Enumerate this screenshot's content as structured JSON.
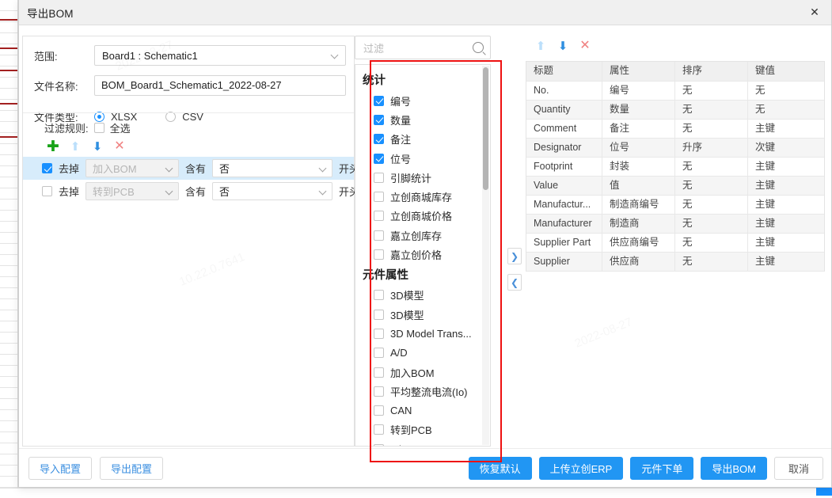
{
  "window": {
    "title": "导出BOM",
    "close_icon": "close-icon"
  },
  "form": {
    "scope_label": "范围:",
    "scope_value": "Board1 : Schematic1",
    "filename_label": "文件名称:",
    "filename_value": "BOM_Board1_Schematic1_2022-08-27",
    "filetype_label": "文件类型:",
    "filetype_options": [
      {
        "label": "XLSX",
        "checked": true
      },
      {
        "label": "CSV",
        "checked": false
      }
    ]
  },
  "filter_rules": {
    "section_label": "过滤规则:",
    "select_all_label": "全选",
    "select_all_checked": false,
    "toolbar": [
      {
        "name": "add-rule-button",
        "glyph": "✚",
        "class": "ico-plus"
      },
      {
        "name": "move-up-button",
        "glyph": "⬆",
        "class": "ico-up"
      },
      {
        "name": "move-down-button",
        "glyph": "⬇",
        "class": "ico-down"
      },
      {
        "name": "delete-rule-button",
        "glyph": "✕",
        "class": "ico-x"
      }
    ],
    "rows": [
      {
        "checked": true,
        "selected": true,
        "action": "去掉",
        "field": "加入BOM",
        "operator": "含有",
        "value": "否",
        "suffix": "开头项"
      },
      {
        "checked": false,
        "selected": false,
        "action": "去掉",
        "field": "转到PCB",
        "operator": "含有",
        "value": "否",
        "suffix": "开头项"
      }
    ]
  },
  "field_picker": {
    "search_placeholder": "过滤",
    "search_icon": "search-icon",
    "groups": [
      {
        "title": "统计",
        "items": [
          {
            "label": "编号",
            "checked": true
          },
          {
            "label": "数量",
            "checked": true
          },
          {
            "label": "备注",
            "checked": true
          },
          {
            "label": "位号",
            "checked": true
          },
          {
            "label": "引脚统计",
            "checked": false
          },
          {
            "label": "立创商城库存",
            "checked": false
          },
          {
            "label": "立创商城价格",
            "checked": false
          },
          {
            "label": "嘉立创库存",
            "checked": false
          },
          {
            "label": "嘉立创价格",
            "checked": false
          }
        ]
      },
      {
        "title": "元件属性",
        "items": [
          {
            "label": "3D模型",
            "checked": false
          },
          {
            "label": "3D模型",
            "checked": false
          },
          {
            "label": "3D Model Trans...",
            "checked": false
          },
          {
            "label": "A/D",
            "checked": false
          },
          {
            "label": "加入BOM",
            "checked": false
          },
          {
            "label": "平均整流电流(Io)",
            "checked": false
          },
          {
            "label": "CAN",
            "checked": false
          },
          {
            "label": "转到PCB",
            "checked": false
          },
          {
            "label": "D/A",
            "checked": false
          }
        ]
      }
    ]
  },
  "transfer": {
    "to_right_label": "❯",
    "to_left_label": "❮"
  },
  "bom_table": {
    "toolbar": [
      {
        "name": "column-move-up-button",
        "glyph": "⬆",
        "class": "ico-up"
      },
      {
        "name": "column-move-down-button",
        "glyph": "⬇",
        "class": "ico-down"
      },
      {
        "name": "column-delete-button",
        "glyph": "✕",
        "class": "ico-x"
      }
    ],
    "columns": [
      "标题",
      "属性",
      "排序",
      "键值"
    ],
    "rows": [
      [
        "No.",
        "编号",
        "无",
        "无"
      ],
      [
        "Quantity",
        "数量",
        "无",
        "无"
      ],
      [
        "Comment",
        "备注",
        "无",
        "主键"
      ],
      [
        "Designator",
        "位号",
        "升序",
        "次键"
      ],
      [
        "Footprint",
        "封装",
        "无",
        "主键"
      ],
      [
        "Value",
        "值",
        "无",
        "主键"
      ],
      [
        "Manufactur...",
        "制造商编号",
        "无",
        "主键"
      ],
      [
        "Manufacturer",
        "制造商",
        "无",
        "主键"
      ],
      [
        "Supplier Part",
        "供应商编号",
        "无",
        "主键"
      ],
      [
        "Supplier",
        "供应商",
        "无",
        "主键"
      ]
    ]
  },
  "footer": {
    "left_buttons": [
      {
        "label": "导入配置",
        "style": "ghost"
      },
      {
        "label": "导出配置",
        "style": "ghost"
      }
    ],
    "right_buttons": [
      {
        "label": "恢复默认",
        "style": "primary"
      },
      {
        "label": "上传立创ERP",
        "style": "primary"
      },
      {
        "label": "元件下单",
        "style": "primary"
      },
      {
        "label": "导出BOM",
        "style": "primary"
      },
      {
        "label": "取消",
        "style": "ghost-neutral"
      }
    ]
  },
  "colors": {
    "accent": "#2196f3",
    "annotation": "#ee1111",
    "row_selected": "#d7ecfb",
    "add_icon": "#18a318",
    "delete_icon": "#f08080"
  }
}
